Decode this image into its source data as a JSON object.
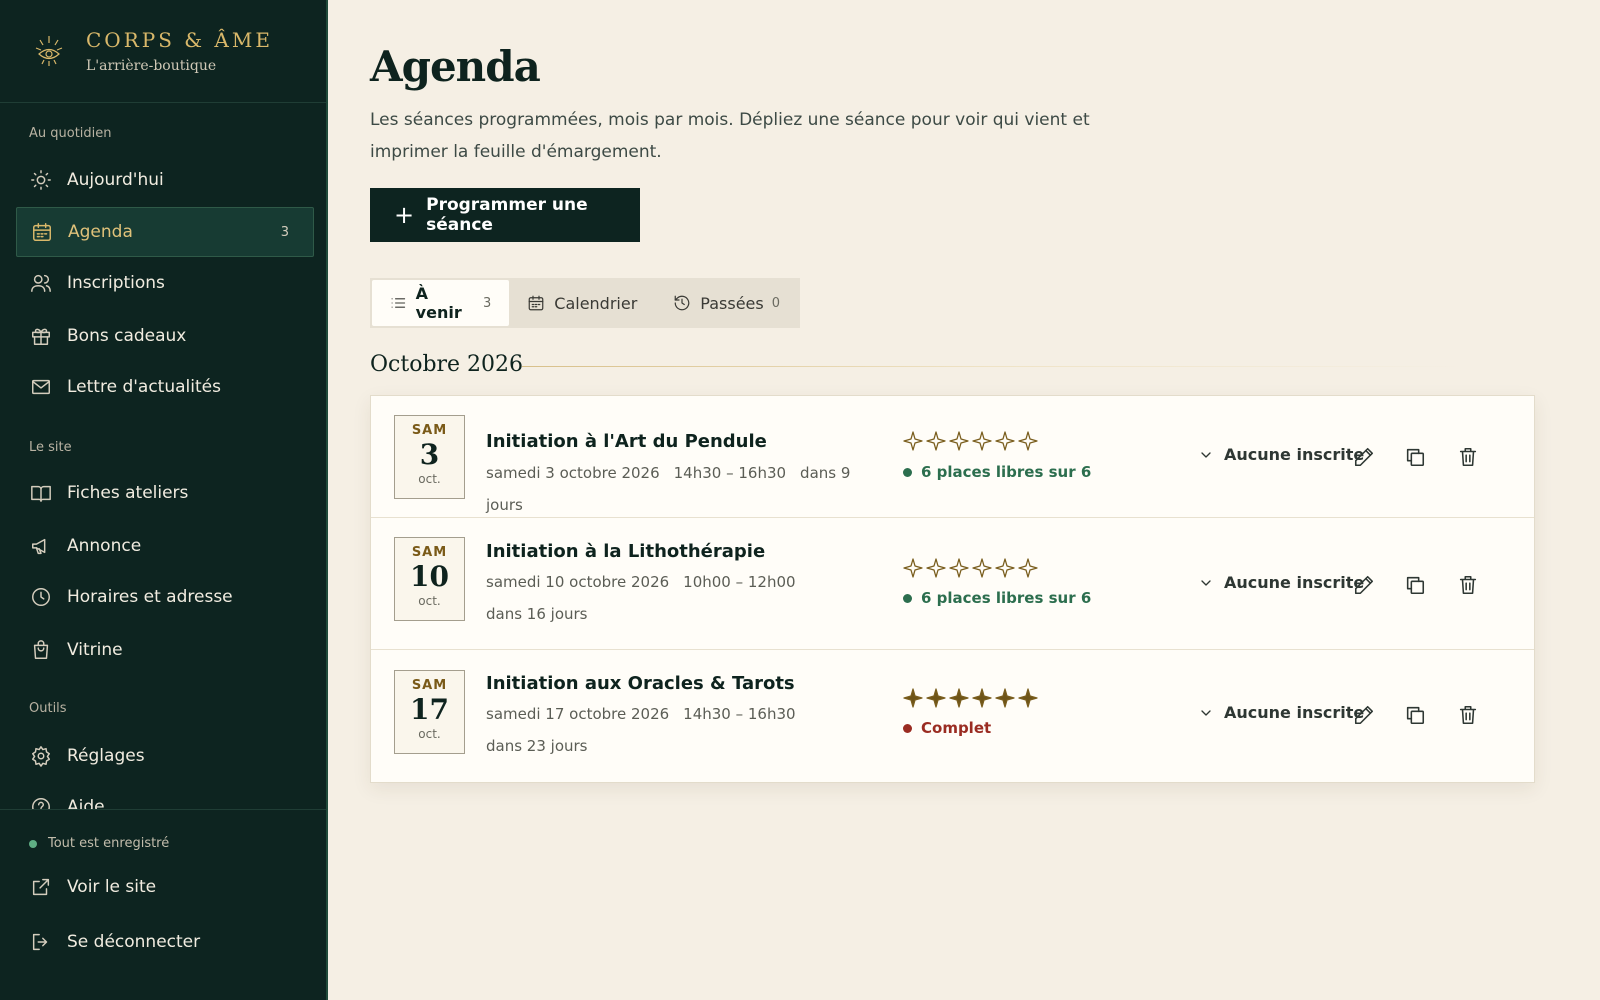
{
  "brand": {
    "title": "CORPS & ÂME",
    "subtitle": "L'arrière-boutique"
  },
  "sidebar": {
    "section_daily": "Au quotidien",
    "section_site": "Le site",
    "section_tools": "Outils",
    "items": [
      {
        "label": "Aujourd'hui",
        "icon": "sun-icon"
      },
      {
        "label": "Agenda",
        "icon": "calendar-icon",
        "count": "3",
        "active": true
      },
      {
        "label": "Inscriptions",
        "icon": "users-icon"
      },
      {
        "label": "Bons cadeaux",
        "icon": "gift-icon"
      },
      {
        "label": "Lettre d'actualités",
        "icon": "mail-icon"
      },
      {
        "label": "Fiches ateliers",
        "icon": "book-icon"
      },
      {
        "label": "Annonce",
        "icon": "megaphone-icon"
      },
      {
        "label": "Horaires et adresse",
        "icon": "clock-icon"
      },
      {
        "label": "Vitrine",
        "icon": "shopping-bag-icon"
      },
      {
        "label": "Réglages",
        "icon": "gear-icon"
      },
      {
        "label": "Aide",
        "icon": "help-icon"
      }
    ],
    "saved_status": "Tout est enregistré",
    "bottom_items": [
      {
        "label": "Voir le site",
        "icon": "external-link-icon"
      },
      {
        "label": "Se déconnecter",
        "icon": "logout-icon"
      }
    ]
  },
  "page": {
    "title": "Agenda",
    "description": "Les séances programmées, mois par mois. Dépliez une séance pour voir qui vient et imprimer la feuille d'émargement.",
    "primary_button": "Programmer une séance"
  },
  "tabs": [
    {
      "label": "À venir",
      "count": "3",
      "icon": "list-icon",
      "active": true
    },
    {
      "label": "Calendrier",
      "count": "",
      "icon": "calendar-icon"
    },
    {
      "label": "Passées",
      "count": "0",
      "icon": "history-icon"
    }
  ],
  "month_label": "Octobre 2026",
  "sessions": [
    {
      "dow": "SAM",
      "day": "3",
      "month": "oct.",
      "title": "Initiation à l'Art du Pendule",
      "date": "samedi 3 octobre 2026",
      "time": "14h30 – 16h30",
      "relative": "dans 9 jours",
      "capacity": 6,
      "booked": 0,
      "status": "6 places libres sur 6",
      "status_type": "free",
      "registrations": "Aucune inscrite"
    },
    {
      "dow": "SAM",
      "day": "10",
      "month": "oct.",
      "title": "Initiation à la Lithothérapie",
      "date": "samedi 10 octobre 2026",
      "time": "10h00 – 12h00",
      "relative": "dans 16 jours",
      "capacity": 6,
      "booked": 0,
      "status": "6 places libres sur 6",
      "status_type": "free",
      "registrations": "Aucune inscrite"
    },
    {
      "dow": "SAM",
      "day": "17",
      "month": "oct.",
      "title": "Initiation aux Oracles & Tarots",
      "date": "samedi 17 octobre 2026",
      "time": "14h30 – 16h30",
      "relative": "dans 23 jours",
      "capacity": 6,
      "booked": 6,
      "status": "Complet",
      "status_type": "full",
      "registrations": "Aucune inscrite"
    }
  ],
  "colors": {
    "sidebar_bg": "#0d2420",
    "accent_gold": "#d9b86a",
    "free": "#2c6e4e",
    "full": "#9a2c22",
    "page_bg": "#f5efe4"
  }
}
